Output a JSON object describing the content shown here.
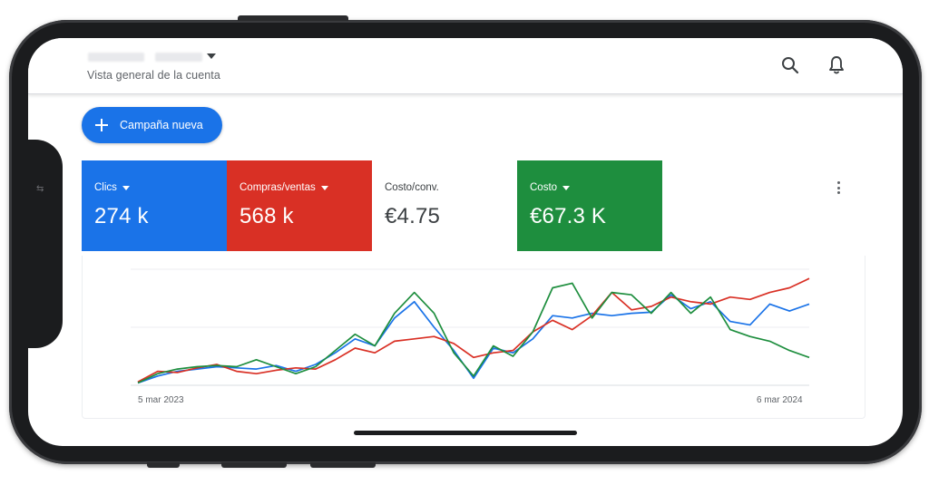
{
  "header": {
    "account_subtitle": "Vista general de la cuenta",
    "icons": [
      "search-icon",
      "bell-icon"
    ]
  },
  "actions": {
    "new_campaign_label": "Campaña nueva"
  },
  "metrics": [
    {
      "label": "Clics",
      "value": "274 k",
      "color": "#1a73e8",
      "dropdown": true
    },
    {
      "label": "Compras/ventas",
      "value": "568 k",
      "color": "#d93025",
      "dropdown": true
    },
    {
      "label": "Costo/conv.",
      "value": "€4.75",
      "color": "#ffffff",
      "dropdown": false
    },
    {
      "label": "Costo",
      "value": "€67.3 K",
      "color": "#1e8e3e",
      "dropdown": true
    }
  ],
  "chart_data": {
    "type": "line",
    "x_start_label": "5 mar 2023",
    "x_end_label": "6 mar 2024",
    "ylim": [
      0,
      100
    ],
    "grid": true,
    "series": [
      {
        "color": "#1a73e8",
        "values": [
          2,
          8,
          12,
          14,
          16,
          15,
          14,
          17,
          12,
          18,
          28,
          40,
          34,
          58,
          72,
          50,
          30,
          6,
          32,
          28,
          40,
          60,
          58,
          62,
          60,
          62,
          63,
          78,
          66,
          72,
          55,
          52,
          70,
          64,
          70
        ]
      },
      {
        "color": "#d93025",
        "values": [
          3,
          12,
          11,
          15,
          18,
          12,
          10,
          13,
          15,
          14,
          22,
          32,
          28,
          38,
          40,
          42,
          36,
          24,
          28,
          30,
          46,
          56,
          48,
          60,
          80,
          65,
          68,
          76,
          72,
          70,
          76,
          74,
          80,
          84,
          92
        ]
      },
      {
        "color": "#1e8e3e",
        "values": [
          2,
          10,
          14,
          16,
          17,
          16,
          22,
          16,
          10,
          16,
          30,
          44,
          34,
          62,
          80,
          62,
          28,
          8,
          34,
          25,
          46,
          84,
          88,
          58,
          80,
          78,
          62,
          80,
          62,
          76,
          48,
          42,
          38,
          30,
          24
        ]
      }
    ]
  }
}
